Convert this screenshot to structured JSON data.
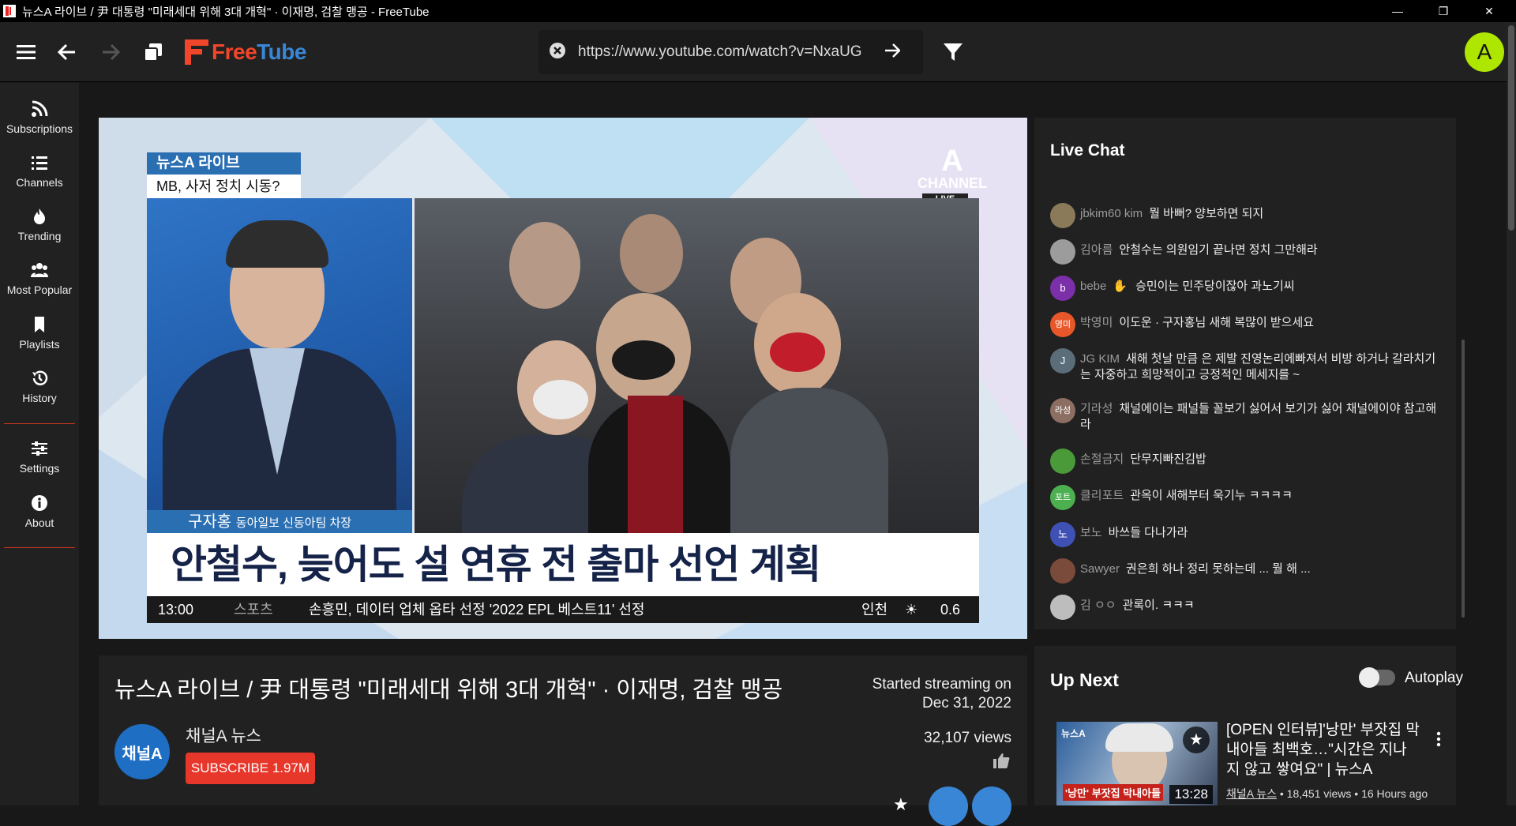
{
  "window": {
    "title": "뉴스A 라이브 / 尹 대통령 \"미래세대 위해 3대 개혁\" · 이재명, 검찰 맹공 - FreeTube",
    "controls": {
      "minimize": "—",
      "maximize": "❐",
      "close": "✕"
    }
  },
  "app": {
    "logo_free": "Free",
    "logo_tube": "Tube"
  },
  "toolbar": {
    "url_value": "https://www.youtube.com/watch?v=NxaUG",
    "account_initial": "A"
  },
  "sidebar": {
    "items": [
      {
        "label": "Subscriptions",
        "icon": "rss-icon"
      },
      {
        "label": "Channels",
        "icon": "list-icon"
      },
      {
        "label": "Trending",
        "icon": "fire-icon"
      },
      {
        "label": "Most Popular",
        "icon": "users-icon"
      },
      {
        "label": "Playlists",
        "icon": "bookmark-icon"
      },
      {
        "label": "History",
        "icon": "history-icon"
      },
      {
        "label": "Settings",
        "icon": "sliders-icon"
      },
      {
        "label": "About",
        "icon": "info-icon"
      }
    ]
  },
  "video_frame": {
    "badge": "뉴스A 라이브",
    "badge_sub": "MB, 사저 정치 시동?",
    "channel_logo": "CHANNEL",
    "live_tag": "LIVE",
    "name": "구자홍",
    "name_role": "동아일보 신동아팀 차장",
    "headline": "안철수, 늦어도 설 연휴 전 출마 선언 계획",
    "ticker_time": "13:00",
    "ticker_section": "스포츠",
    "ticker_text": "손흥민, 데이터 업체 옵타 선정 '2022 EPL 베스트11' 선정",
    "weather_city": "인천",
    "weather_value": "0.6"
  },
  "video_info": {
    "title": "뉴스A 라이브 / 尹 대통령 \"미래세대 위해 3대 개혁\" · 이재명, 검찰 맹공",
    "started_line1": "Started streaming on",
    "started_line2": "Dec 31, 2022",
    "channel_name": "채널A 뉴스",
    "channel_avatar_text": "채널A",
    "subscribe_label": "SUBSCRIBE 1.97M",
    "views": "32,107 views"
  },
  "live_chat": {
    "title": "Live Chat",
    "messages": [
      {
        "name": "jbkim60 kim",
        "text": "뭘 바뻐? 양보하면 되지",
        "avatar": "",
        "color": "#8a7a5a"
      },
      {
        "name": "김아름",
        "text": "안철수는 의원임기 끝나면 정치 그만해라",
        "avatar": "",
        "color": "#9c9c9c"
      },
      {
        "name": "bebe",
        "text": "승민이는 민주당이잖아 과노기씨",
        "avatar": "b",
        "color": "#7b2fa8"
      },
      {
        "name": "박영미",
        "text": "이도운 · 구자홍님 새해 복많이 받으세요",
        "avatar": "영미",
        "color": "#e8572a"
      },
      {
        "name": "JG KIM",
        "text": "새해 첫날 만큼 은 제발 진영논리에빠져서 비방 하거나 갈라치기는 자중하고 희망적이고 긍정적인 메세지를 ~",
        "avatar": "J",
        "color": "#5c6d7a"
      },
      {
        "name": "기라성",
        "text": "채널에이는 패널들 꼴보기 싫어서 보기가 싫어 채널에이야 참고해라",
        "avatar": "라성",
        "color": "#8d6e63"
      },
      {
        "name": "손절금지",
        "text": "단무지빠진김밥",
        "avatar": "",
        "color": "#4a9a3a"
      },
      {
        "name": "클리포트",
        "text": "관옥이 새해부터 욱기누 ㅋㅋㅋㅋ",
        "avatar": "포트",
        "color": "#4caf50"
      },
      {
        "name": "보노",
        "text": "바쓰들 다나가라",
        "avatar": "노",
        "color": "#3f51b5"
      },
      {
        "name": "Sawyer",
        "text": "권은희 하나 정리 못하는데 ... 뭘 해 ...",
        "avatar": "",
        "color": "#7a4a3a"
      },
      {
        "name": "김 ㅇㅇ",
        "text": "관록이. ㅋㅋㅋ",
        "avatar": "",
        "color": "#bdbdbd"
      }
    ]
  },
  "up_next": {
    "title": "Up Next",
    "autoplay_label": "Autoplay",
    "video": {
      "title": "[OPEN 인터뷰]'낭만' 부잣집 막내아들 최백호…\"시간은 지나지 않고 쌓여요\" | 뉴스A",
      "channel": "채널A 뉴스",
      "meta": "• 18,451 views • 16 Hours ago",
      "duration": "13:28",
      "thumb_caption": "'낭만' 부잣집 막내아들"
    }
  }
}
